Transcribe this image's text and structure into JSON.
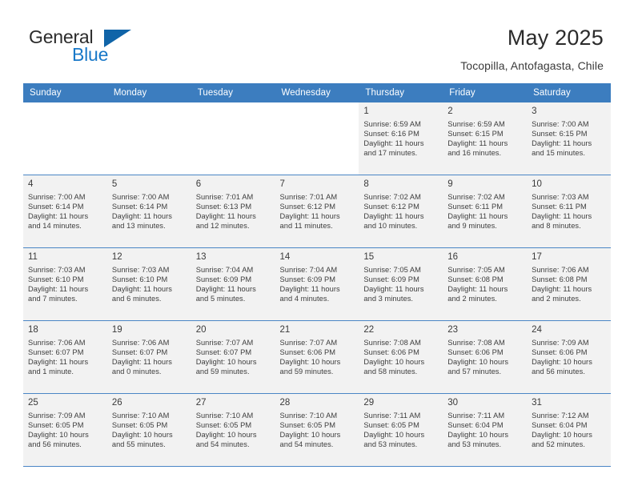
{
  "brand": {
    "name_part1": "General",
    "name_part2": "Blue",
    "accent_color": "#1878c8",
    "triangle_color": "#1064a8",
    "logo_icon": "triangle-flag-icon"
  },
  "header": {
    "title": "May 2025",
    "subtitle": "Tocopilla, Antofagasta, Chile"
  },
  "theme": {
    "header_row_bg": "#3c7dbf",
    "header_row_text": "#ffffff",
    "row_divider": "#4a86c5",
    "shaded_cell_bg": "#f2f2f2",
    "body_text": "#3d3d3d"
  },
  "labels": {
    "sunrise_prefix": "Sunrise:",
    "sunset_prefix": "Sunset:",
    "daylight_prefix": "Daylight:"
  },
  "weekday_headers": [
    "Sunday",
    "Monday",
    "Tuesday",
    "Wednesday",
    "Thursday",
    "Friday",
    "Saturday"
  ],
  "weeks": [
    [
      {
        "day": "",
        "line1": "",
        "line2": "",
        "line3": "",
        "line4": "",
        "shaded": false
      },
      {
        "day": "",
        "line1": "",
        "line2": "",
        "line3": "",
        "line4": "",
        "shaded": false
      },
      {
        "day": "",
        "line1": "",
        "line2": "",
        "line3": "",
        "line4": "",
        "shaded": false
      },
      {
        "day": "",
        "line1": "",
        "line2": "",
        "line3": "",
        "line4": "",
        "shaded": false
      },
      {
        "day": "1",
        "line1": "Sunrise: 6:59 AM",
        "line2": "Sunset: 6:16 PM",
        "line3": "Daylight: 11 hours",
        "line4": "and 17 minutes.",
        "shaded": true
      },
      {
        "day": "2",
        "line1": "Sunrise: 6:59 AM",
        "line2": "Sunset: 6:15 PM",
        "line3": "Daylight: 11 hours",
        "line4": "and 16 minutes.",
        "shaded": true
      },
      {
        "day": "3",
        "line1": "Sunrise: 7:00 AM",
        "line2": "Sunset: 6:15 PM",
        "line3": "Daylight: 11 hours",
        "line4": "and 15 minutes.",
        "shaded": true
      }
    ],
    [
      {
        "day": "4",
        "line1": "Sunrise: 7:00 AM",
        "line2": "Sunset: 6:14 PM",
        "line3": "Daylight: 11 hours",
        "line4": "and 14 minutes.",
        "shaded": true
      },
      {
        "day": "5",
        "line1": "Sunrise: 7:00 AM",
        "line2": "Sunset: 6:14 PM",
        "line3": "Daylight: 11 hours",
        "line4": "and 13 minutes.",
        "shaded": true
      },
      {
        "day": "6",
        "line1": "Sunrise: 7:01 AM",
        "line2": "Sunset: 6:13 PM",
        "line3": "Daylight: 11 hours",
        "line4": "and 12 minutes.",
        "shaded": true
      },
      {
        "day": "7",
        "line1": "Sunrise: 7:01 AM",
        "line2": "Sunset: 6:12 PM",
        "line3": "Daylight: 11 hours",
        "line4": "and 11 minutes.",
        "shaded": true
      },
      {
        "day": "8",
        "line1": "Sunrise: 7:02 AM",
        "line2": "Sunset: 6:12 PM",
        "line3": "Daylight: 11 hours",
        "line4": "and 10 minutes.",
        "shaded": true
      },
      {
        "day": "9",
        "line1": "Sunrise: 7:02 AM",
        "line2": "Sunset: 6:11 PM",
        "line3": "Daylight: 11 hours",
        "line4": "and 9 minutes.",
        "shaded": true
      },
      {
        "day": "10",
        "line1": "Sunrise: 7:03 AM",
        "line2": "Sunset: 6:11 PM",
        "line3": "Daylight: 11 hours",
        "line4": "and 8 minutes.",
        "shaded": true
      }
    ],
    [
      {
        "day": "11",
        "line1": "Sunrise: 7:03 AM",
        "line2": "Sunset: 6:10 PM",
        "line3": "Daylight: 11 hours",
        "line4": "and 7 minutes.",
        "shaded": true
      },
      {
        "day": "12",
        "line1": "Sunrise: 7:03 AM",
        "line2": "Sunset: 6:10 PM",
        "line3": "Daylight: 11 hours",
        "line4": "and 6 minutes.",
        "shaded": true
      },
      {
        "day": "13",
        "line1": "Sunrise: 7:04 AM",
        "line2": "Sunset: 6:09 PM",
        "line3": "Daylight: 11 hours",
        "line4": "and 5 minutes.",
        "shaded": true
      },
      {
        "day": "14",
        "line1": "Sunrise: 7:04 AM",
        "line2": "Sunset: 6:09 PM",
        "line3": "Daylight: 11 hours",
        "line4": "and 4 minutes.",
        "shaded": true
      },
      {
        "day": "15",
        "line1": "Sunrise: 7:05 AM",
        "line2": "Sunset: 6:09 PM",
        "line3": "Daylight: 11 hours",
        "line4": "and 3 minutes.",
        "shaded": true
      },
      {
        "day": "16",
        "line1": "Sunrise: 7:05 AM",
        "line2": "Sunset: 6:08 PM",
        "line3": "Daylight: 11 hours",
        "line4": "and 2 minutes.",
        "shaded": true
      },
      {
        "day": "17",
        "line1": "Sunrise: 7:06 AM",
        "line2": "Sunset: 6:08 PM",
        "line3": "Daylight: 11 hours",
        "line4": "and 2 minutes.",
        "shaded": true
      }
    ],
    [
      {
        "day": "18",
        "line1": "Sunrise: 7:06 AM",
        "line2": "Sunset: 6:07 PM",
        "line3": "Daylight: 11 hours",
        "line4": "and 1 minute.",
        "shaded": true
      },
      {
        "day": "19",
        "line1": "Sunrise: 7:06 AM",
        "line2": "Sunset: 6:07 PM",
        "line3": "Daylight: 11 hours",
        "line4": "and 0 minutes.",
        "shaded": true
      },
      {
        "day": "20",
        "line1": "Sunrise: 7:07 AM",
        "line2": "Sunset: 6:07 PM",
        "line3": "Daylight: 10 hours",
        "line4": "and 59 minutes.",
        "shaded": true
      },
      {
        "day": "21",
        "line1": "Sunrise: 7:07 AM",
        "line2": "Sunset: 6:06 PM",
        "line3": "Daylight: 10 hours",
        "line4": "and 59 minutes.",
        "shaded": true
      },
      {
        "day": "22",
        "line1": "Sunrise: 7:08 AM",
        "line2": "Sunset: 6:06 PM",
        "line3": "Daylight: 10 hours",
        "line4": "and 58 minutes.",
        "shaded": true
      },
      {
        "day": "23",
        "line1": "Sunrise: 7:08 AM",
        "line2": "Sunset: 6:06 PM",
        "line3": "Daylight: 10 hours",
        "line4": "and 57 minutes.",
        "shaded": true
      },
      {
        "day": "24",
        "line1": "Sunrise: 7:09 AM",
        "line2": "Sunset: 6:06 PM",
        "line3": "Daylight: 10 hours",
        "line4": "and 56 minutes.",
        "shaded": true
      }
    ],
    [
      {
        "day": "25",
        "line1": "Sunrise: 7:09 AM",
        "line2": "Sunset: 6:05 PM",
        "line3": "Daylight: 10 hours",
        "line4": "and 56 minutes.",
        "shaded": true
      },
      {
        "day": "26",
        "line1": "Sunrise: 7:10 AM",
        "line2": "Sunset: 6:05 PM",
        "line3": "Daylight: 10 hours",
        "line4": "and 55 minutes.",
        "shaded": true
      },
      {
        "day": "27",
        "line1": "Sunrise: 7:10 AM",
        "line2": "Sunset: 6:05 PM",
        "line3": "Daylight: 10 hours",
        "line4": "and 54 minutes.",
        "shaded": true
      },
      {
        "day": "28",
        "line1": "Sunrise: 7:10 AM",
        "line2": "Sunset: 6:05 PM",
        "line3": "Daylight: 10 hours",
        "line4": "and 54 minutes.",
        "shaded": true
      },
      {
        "day": "29",
        "line1": "Sunrise: 7:11 AM",
        "line2": "Sunset: 6:05 PM",
        "line3": "Daylight: 10 hours",
        "line4": "and 53 minutes.",
        "shaded": true
      },
      {
        "day": "30",
        "line1": "Sunrise: 7:11 AM",
        "line2": "Sunset: 6:04 PM",
        "line3": "Daylight: 10 hours",
        "line4": "and 53 minutes.",
        "shaded": true
      },
      {
        "day": "31",
        "line1": "Sunrise: 7:12 AM",
        "line2": "Sunset: 6:04 PM",
        "line3": "Daylight: 10 hours",
        "line4": "and 52 minutes.",
        "shaded": true
      }
    ]
  ]
}
